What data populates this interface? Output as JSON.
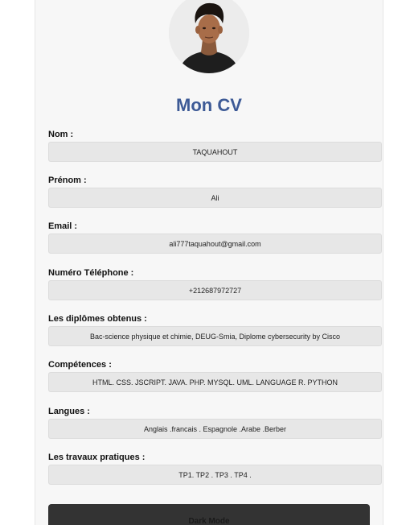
{
  "header": {
    "title": "Mon CV"
  },
  "profile": {
    "avatar_icon": "profile-photo"
  },
  "fields": [
    {
      "label": "Nom :",
      "value": "TAQUAHOUT"
    },
    {
      "label": "Prénom :",
      "value": "Ali"
    },
    {
      "label": "Email :",
      "value": "ali777taquahout@gmail.com"
    },
    {
      "label": "Numéro Téléphone :",
      "value": "+212687972727"
    },
    {
      "label": "Les diplômes obtenus :",
      "value": "Bac-science physique et chimie, DEUG-Smia, Diplome cybersecurity by Cisco"
    },
    {
      "label": "Compétences :",
      "value": "HTML. CSS. JSCRIPT. JAVA. PHP. MYSQL. UML. LANGUAGE R. PYTHON"
    },
    {
      "label": "Langues :",
      "value": "Anglais .francais . Espagnole .Arabe .Berber"
    },
    {
      "label": "Les travaux pratiques :",
      "value": "TP1. TP2 . TP3 . TP4 ."
    }
  ],
  "actions": {
    "dark_mode_label": "Dark Mode"
  },
  "colors": {
    "title": "#3d5a96",
    "field_background": "#e7e7e7",
    "card_background": "#f7f7f7",
    "button_background": "#333333"
  }
}
